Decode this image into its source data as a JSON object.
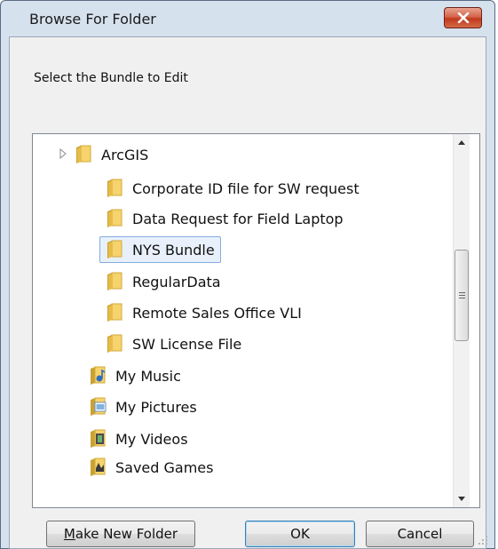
{
  "dialog": {
    "title": "Browse For Folder",
    "instruction": "Select the Bundle to Edit"
  },
  "tree": {
    "items": [
      {
        "label": "ArcGIS",
        "icon": "folder-icon",
        "expandable": true
      },
      {
        "label": "Corporate ID file for SW request",
        "icon": "folder-icon"
      },
      {
        "label": "Data Request for Field Laptop",
        "icon": "folder-icon"
      },
      {
        "label": "NYS Bundle",
        "icon": "folder-icon",
        "selected": true
      },
      {
        "label": "RegularData",
        "icon": "folder-icon"
      },
      {
        "label": "Remote Sales Office VLI",
        "icon": "folder-icon"
      },
      {
        "label": "SW License File",
        "icon": "folder-icon"
      },
      {
        "label": "My Music",
        "icon": "music-folder-icon"
      },
      {
        "label": "My Pictures",
        "icon": "pictures-folder-icon"
      },
      {
        "label": "My Videos",
        "icon": "videos-folder-icon"
      },
      {
        "label": "Saved Games",
        "icon": "saved-games-folder-icon"
      }
    ]
  },
  "buttons": {
    "make_new_folder_mnemonic": "M",
    "make_new_folder_rest": "ake New Folder",
    "ok": "OK",
    "cancel": "Cancel"
  },
  "colors": {
    "selection_border": "#84acdd",
    "selection_fill": "#e8f1fb",
    "close_button": "#c7432a",
    "frame": "#d6e1ee"
  }
}
